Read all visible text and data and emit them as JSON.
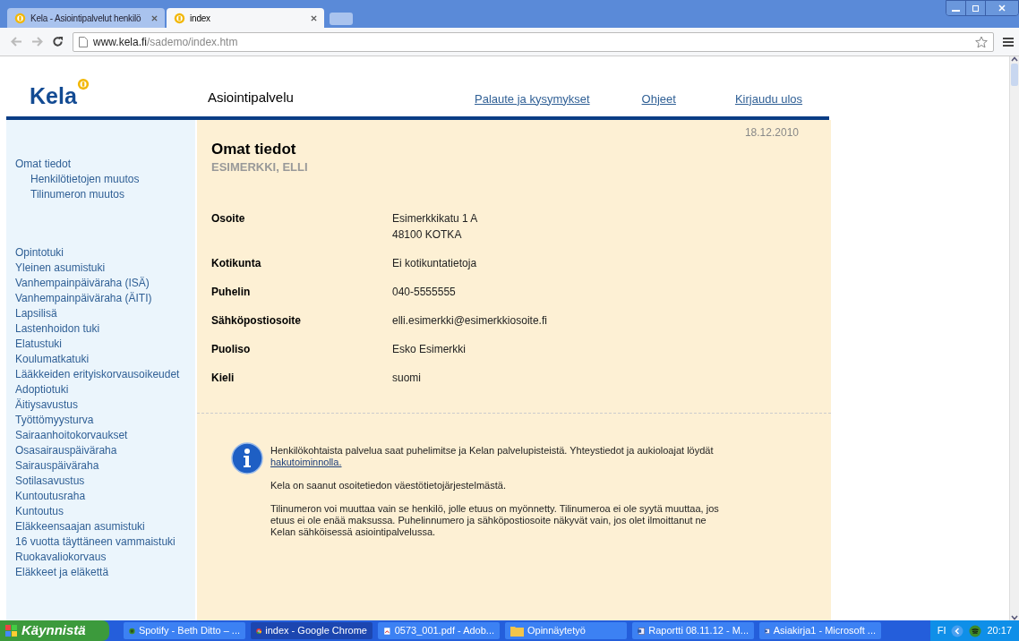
{
  "browser": {
    "tabs": [
      {
        "title": "Kela - Asiointipalvelut henkilö",
        "selected": false
      },
      {
        "title": "index",
        "selected": true
      }
    ],
    "url_host": "www.kela.fi",
    "url_path": "/sademo/index.htm"
  },
  "header": {
    "logo": "Kela",
    "service": "Asiointipalvelu",
    "links": [
      "Palaute ja kysymykset",
      "Ohjeet",
      "Kirjaudu ulos"
    ]
  },
  "sidebar": {
    "groups": [
      [
        {
          "label": "Omat tiedot",
          "children": [
            {
              "label": "Henkilötietojen muutos"
            },
            {
              "label": "Tilinumeron muutos"
            }
          ]
        }
      ],
      [
        {
          "label": "Opintotuki"
        },
        {
          "label": "Yleinen asumistuki"
        },
        {
          "label": "Vanhempainpäiväraha (ISÄ)"
        },
        {
          "label": "Vanhempainpäiväraha (ÄITI)"
        },
        {
          "label": "Lapsilisä"
        },
        {
          "label": "Lastenhoidon tuki"
        },
        {
          "label": "Elatustuki"
        },
        {
          "label": "Koulumatkatuki"
        },
        {
          "label": "Lääkkeiden erityiskorvausoikeudet"
        },
        {
          "label": "Adoptiotuki"
        },
        {
          "label": "Äitiysavustus"
        },
        {
          "label": "Työttömyysturva"
        },
        {
          "label": "Sairaanhoitokorvaukset"
        },
        {
          "label": "Osasairauspäiväraha"
        },
        {
          "label": "Sairauspäiväraha"
        },
        {
          "label": "Sotilasavustus"
        },
        {
          "label": "Kuntoutusraha"
        },
        {
          "label": "Kuntoutus"
        },
        {
          "label": "Eläkkeensaajan asumistuki"
        },
        {
          "label": "16 vuotta täyttäneen vammaistuki"
        },
        {
          "label": "Ruokavaliokorvaus"
        },
        {
          "label": "Eläkkeet ja eläkettä"
        }
      ]
    ]
  },
  "content": {
    "date": "18.12.2010",
    "title": "Omat tiedot",
    "name": "ESIMERKKI, ELLI",
    "fields": [
      {
        "label": "Osoite",
        "value": [
          "Esimerkkikatu 1 A",
          "48100 KOTKA"
        ]
      },
      {
        "label": "Kotikunta",
        "value": [
          "Ei kotikuntatietoja"
        ]
      },
      {
        "label": "Puhelin",
        "value": [
          "040-5555555"
        ]
      },
      {
        "label": "Sähköpostiosoite",
        "value": [
          "elli.esimerkki@esimerkkiosoite.fi"
        ]
      },
      {
        "label": "Puoliso",
        "value": [
          "Esko Esimerkki"
        ]
      },
      {
        "label": "Kieli",
        "value": [
          "suomi"
        ]
      }
    ],
    "info": {
      "text": "Henkilökohtaista palvelua saat puhelimitse ja Kelan palvelupisteistä. Yhteystiedot ja aukioloajat löydät",
      "link": "hakutoiminnolla.",
      "paragraphs": [
        "Kela on saanut osoitetiedon väestötietojärjestelmästä.",
        "Tilinumeron voi muuttaa vain se henkilö, jolle etuus on myönnetty. Tilinumeroa ei ole syytä muuttaa, jos etuus ei ole enää maksussa. Puhelinnumero ja sähköpostiosoite näkyvät vain, jos olet ilmoittanut ne Kelan sähköisessä asiointipalvelussa."
      ]
    }
  },
  "taskbar": {
    "start": "Käynnistä",
    "items": [
      {
        "kind": "spotify",
        "title": "Spotify - Beth Ditto – ...",
        "selected": false
      },
      {
        "kind": "chrome",
        "title": "index - Google Chrome",
        "selected": true
      },
      {
        "kind": "pdf",
        "title": "0573_001.pdf - Adob...",
        "selected": false
      },
      {
        "kind": "folder",
        "title": "Opinnäytetyö",
        "selected": false
      },
      {
        "kind": "word",
        "title": "Raportti 08.11.12 - M...",
        "selected": false
      },
      {
        "kind": "word",
        "title": "Asiakirja1 - Microsoft ...",
        "selected": false
      }
    ],
    "language": "FI",
    "clock": "20:17"
  }
}
